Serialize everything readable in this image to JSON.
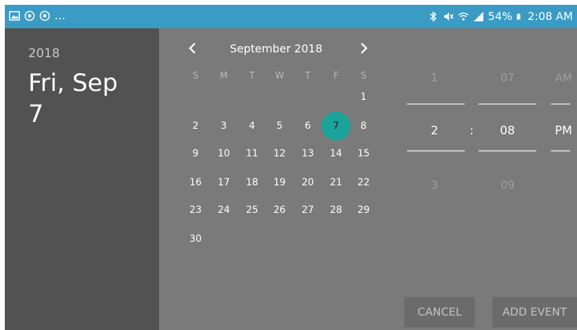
{
  "status_bar": {
    "left_icons": [
      "image-icon",
      "target-icon",
      "target-icon"
    ],
    "left_more": "...",
    "battery_percent": "54%",
    "time": "2:08 AM"
  },
  "date_panel": {
    "year": "2018",
    "date_line1": "Fri, Sep",
    "date_line2": "7"
  },
  "calendar": {
    "month_title": "September 2018",
    "weekdays": [
      "S",
      "M",
      "T",
      "W",
      "T",
      "F",
      "S"
    ],
    "days": [
      "1",
      "2",
      "3",
      "4",
      "5",
      "6",
      "7",
      "8",
      "9",
      "10",
      "11",
      "12",
      "13",
      "14",
      "15",
      "16",
      "17",
      "18",
      "19",
      "20",
      "21",
      "22",
      "23",
      "24",
      "25",
      "26",
      "27",
      "28",
      "29",
      "30"
    ]
  },
  "time_picker": {
    "hour_prev": "1",
    "hour_selected": "2",
    "hour_next": "3",
    "minute_prev": "07",
    "minute_selected": "08",
    "minute_next": "09",
    "separator": ":",
    "ampm_prev": "AM",
    "ampm_selected": "PM"
  },
  "buttons": {
    "cancel": "CANCEL",
    "add_event": "ADD EVENT"
  },
  "colors": {
    "status_bar": "#3a9bc5",
    "selected_day": "#19a39a"
  }
}
